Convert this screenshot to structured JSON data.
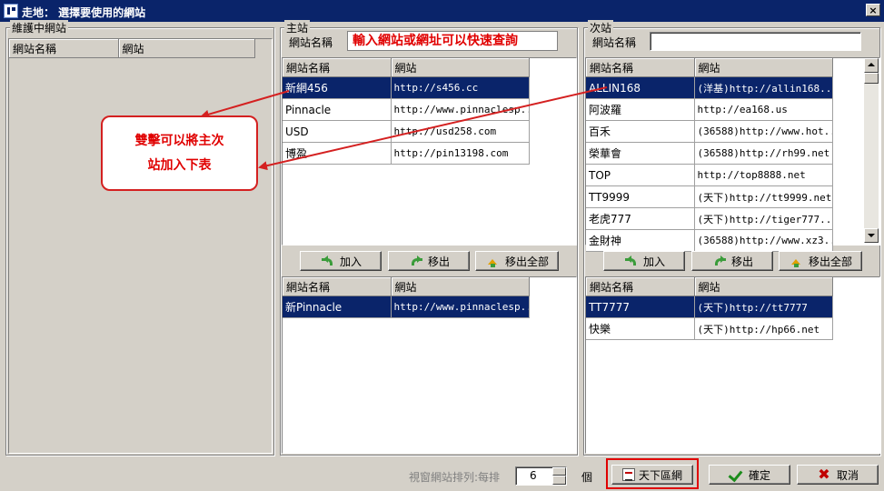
{
  "window": {
    "title": "走地： 選擇要使用的網站",
    "close_label": "×"
  },
  "maintenance": {
    "group_label": "維護中網站",
    "headers": [
      "網站名稱",
      "網站"
    ]
  },
  "main_site": {
    "group_label": "主站",
    "search_label": "網站名稱",
    "search_hint": "輸入網站或網址可以快速查詢",
    "headers": [
      "網站名稱",
      "網站"
    ],
    "rows": [
      {
        "name": "新網456",
        "url": "http://s456.cc",
        "selected": true
      },
      {
        "name": "Pinnacle",
        "url": "http://www.pinnaclesp...",
        "selected": false
      },
      {
        "name": "USD",
        "url": "http://usd258.com",
        "selected": false
      },
      {
        "name": "博盈",
        "url": "http://pin13198.com",
        "selected": false
      }
    ],
    "buttons": {
      "add": "加入",
      "remove": "移出",
      "remove_all": "移出全部"
    },
    "selected_headers": [
      "網站名稱",
      "網站"
    ],
    "selected_rows": [
      {
        "name": "新Pinnacle",
        "url": "http://www.pinnaclesp...",
        "selected": true
      }
    ]
  },
  "sub_site": {
    "group_label": "次站",
    "search_label": "網站名稱",
    "search_value": "",
    "headers": [
      "網站名稱",
      "網站"
    ],
    "rows": [
      {
        "name": "ALLIN168",
        "url": "(洋基)http://allin168....",
        "selected": true
      },
      {
        "name": "阿波羅",
        "url": "http://ea168.us",
        "selected": false
      },
      {
        "name": "百禾",
        "url": "(36588)http://www.hot...",
        "selected": false
      },
      {
        "name": "榮華會",
        "url": "(36588)http://rh99.net",
        "selected": false
      },
      {
        "name": "TOP",
        "url": "http://top8888.net",
        "selected": false
      },
      {
        "name": "TT9999",
        "url": "(天下)http://tt9999.net",
        "selected": false
      },
      {
        "name": "老虎777",
        "url": "(天下)http://tiger777....",
        "selected": false
      },
      {
        "name": "金財神",
        "url": "(36588)http://www.xz3...",
        "selected": false
      }
    ],
    "buttons": {
      "add": "加入",
      "remove": "移出",
      "remove_all": "移出全部"
    },
    "selected_headers": [
      "網站名稱",
      "網站"
    ],
    "selected_rows": [
      {
        "name": "TT7777",
        "url": "(天下)http://tt7777",
        "selected": true
      },
      {
        "name": "快樂",
        "url": "(天下)http://hp66.net",
        "selected": false
      }
    ]
  },
  "callout": {
    "line1": "雙擊可以將主次",
    "line2": "站加入下表"
  },
  "footer": {
    "arrange_label": "視窗網站排列:每排",
    "per_row_value": "6",
    "unit_label": "個",
    "sort_button": "天下區網",
    "ok_button": "確定",
    "cancel_button": "取消"
  },
  "colors": {
    "selection": "#0a246a",
    "annotation_red": "#e00000",
    "window_bg": "#d4d0c8"
  },
  "icons": {
    "add": "green-arrow-icon",
    "remove": "back-arrow-icon",
    "remove_all": "up-arrow-icon",
    "ok": "check-icon",
    "cancel": "x-icon",
    "sort": "sort-icon"
  }
}
